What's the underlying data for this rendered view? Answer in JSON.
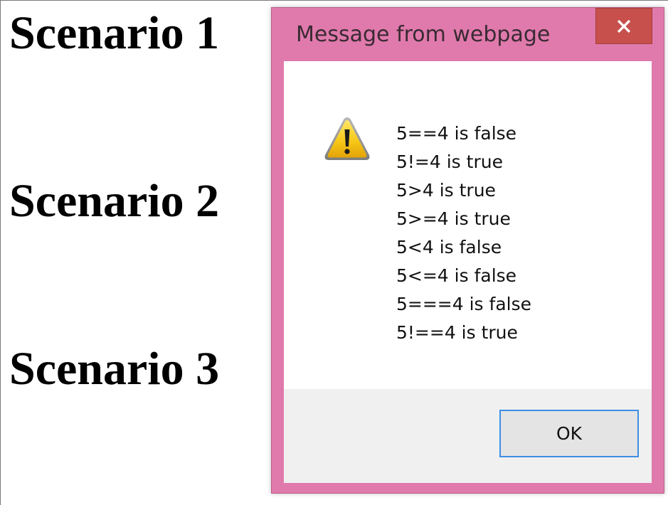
{
  "page": {
    "scenarios": [
      "Scenario 1",
      "Scenario 2",
      "Scenario 3"
    ]
  },
  "dialog": {
    "title": "Message from webpage",
    "close_icon": "close-icon",
    "warning_icon": "warning-icon",
    "messages": [
      "5==4 is false",
      "5!=4 is true",
      "5>4 is true",
      "5>=4 is true",
      "5<4 is false",
      "5<=4 is false",
      "5===4 is false",
      "5!==4 is true"
    ],
    "ok_label": "OK"
  },
  "colors": {
    "frame": "#e07aac",
    "close_button": "#c7504c",
    "ok_focus_border": "#3d8ee6",
    "footer": "#f0f0f0"
  }
}
